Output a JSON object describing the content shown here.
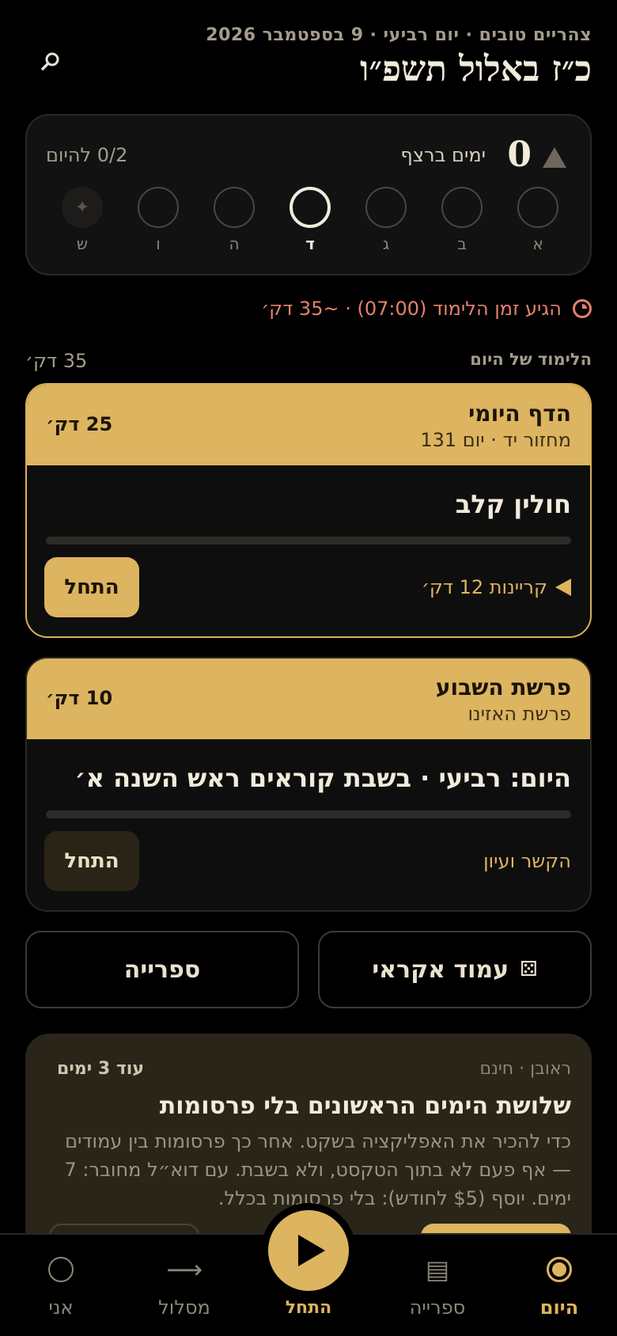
{
  "header": {
    "greeting": "צהריים טובים · יום רביעי · 9 בספטמבר 2026",
    "hebrew_date": "כ״ז באלול תשפ״ו",
    "search_icon": "search-icon"
  },
  "streak": {
    "count": "0",
    "label": "ימים ברצף",
    "today_progress": "0/2 להיום",
    "days": [
      {
        "label": "א",
        "state": "empty"
      },
      {
        "label": "ב",
        "state": "empty"
      },
      {
        "label": "ג",
        "state": "empty"
      },
      {
        "label": "ד",
        "state": "today"
      },
      {
        "label": "ה",
        "state": "empty"
      },
      {
        "label": "ו",
        "state": "empty"
      },
      {
        "label": "ש",
        "state": "shabbat",
        "glyph": "✦"
      }
    ]
  },
  "reminder": {
    "text": "הגיע זמן הלימוד (07:00) · ~35 דק׳"
  },
  "today_study": {
    "title": "הלימוד של היום",
    "total": "35 דק׳",
    "cards": [
      {
        "title": "הדף היומי",
        "subtitle": "מחזור יד · יום 131",
        "duration": "25 דק׳",
        "body": "חולין קלב",
        "link": "קריינות 12 דק׳",
        "button": "התחל",
        "progress": 0
      },
      {
        "title": "פרשת השבוע",
        "subtitle": "פרשת האזינו",
        "duration": "10 דק׳",
        "body": "היום: רביעי · בשבת קוראים ראש השנה א׳",
        "link": "הקשר ועיון",
        "button": "התחל",
        "progress": 0
      }
    ]
  },
  "tiles": {
    "random": "עמוד אקראי",
    "random_glyph": "⚄",
    "library": "ספרייה"
  },
  "promo": {
    "from": "ראובן · חינם",
    "days_left": "עוד 3 ימים",
    "title": "שלושת הימים הראשונים בלי פרסומות",
    "body": "כדי להכיר את האפליקציה בשקט. אחר כך פרסומות בין עמודים — אף פעם לא בתוך הטקסט, ולא בשבת. עם דוא״ל מחובר: 7 ימים. יוסף ($5 לחודש): בלי פרסומות בכלל."
  },
  "tabbar": {
    "today": "היום",
    "library": "ספרייה",
    "start": "התחל",
    "path": "מסלול",
    "me": "אני",
    "library_glyph": "▤",
    "path_glyph": "⟶"
  },
  "colors": {
    "accent": "#ddb45f",
    "background": "#000000",
    "reminder": "#e5826b"
  }
}
